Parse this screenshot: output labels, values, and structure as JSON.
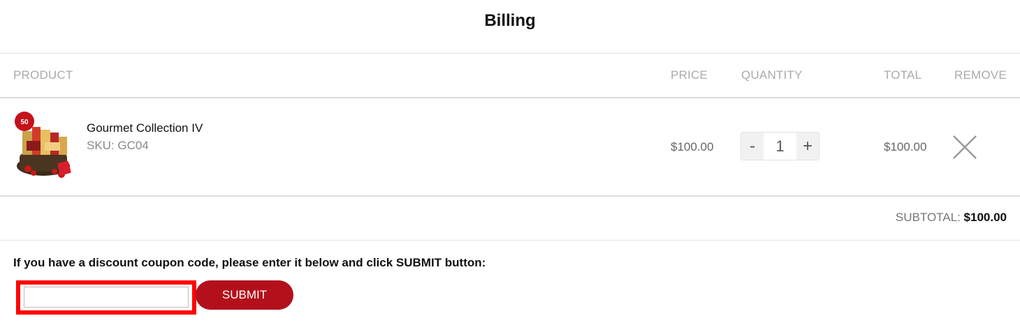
{
  "page": {
    "title": "Billing"
  },
  "table": {
    "headers": {
      "product": "PRODUCT",
      "price": "PRICE",
      "quantity": "QUANTITY",
      "total": "TOTAL",
      "remove": "REMOVE"
    },
    "items": [
      {
        "name": "Gourmet Collection IV",
        "sku": "SKU: GC04",
        "price": "$100.00",
        "quantity": "1",
        "total": "$100.00",
        "badge": "50"
      }
    ],
    "qty_minus": "-",
    "qty_plus": "+"
  },
  "summary": {
    "subtotal_label": "SUBTOTAL:",
    "subtotal_value": "$100.00"
  },
  "coupon": {
    "prompt": "If you have a discount coupon code, please enter it below and click SUBMIT button:",
    "input_value": "",
    "submit_label": "SUBMIT"
  },
  "colors": {
    "accent": "#b3101b",
    "highlight": "#ff0000",
    "muted": "#aaaaaa"
  }
}
